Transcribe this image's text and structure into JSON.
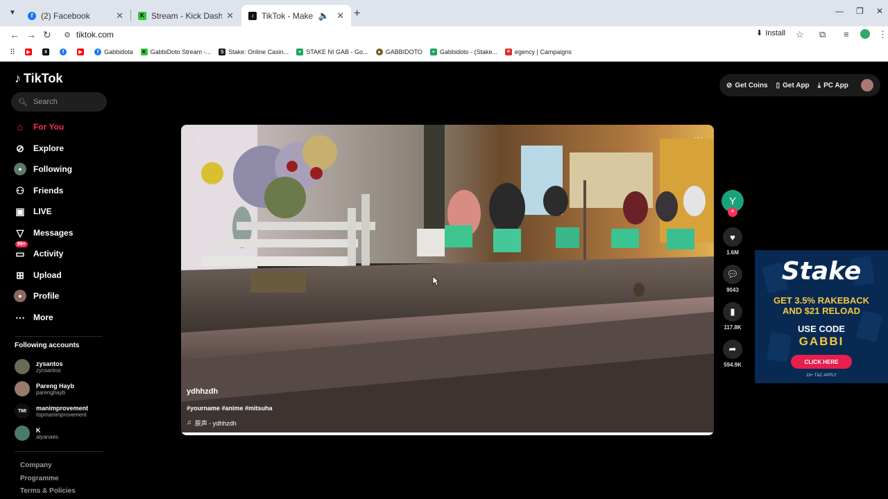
{
  "browser": {
    "tabs": [
      {
        "title": "(2) Facebook",
        "favicon": "f",
        "color": "#1877f2"
      },
      {
        "title": "Stream - Kick Dashboard",
        "favicon": "K",
        "color": "#3ac43a"
      },
      {
        "title": "TikTok - Make Your Day",
        "favicon": "♪",
        "color": "#111111"
      }
    ],
    "url": "tiktok.com",
    "install_label": "Install",
    "bookmarks": [
      {
        "label": "",
        "favicon": "▶",
        "color": "#ff0000"
      },
      {
        "label": "",
        "favicon": "X",
        "color": "#000000"
      },
      {
        "label": "",
        "favicon": "f",
        "color": "#1877f2"
      },
      {
        "label": "",
        "favicon": "▶",
        "color": "#ff0000"
      },
      {
        "label": "Gabbidota",
        "favicon": "f",
        "color": "#1877f2"
      },
      {
        "label": "GabbiDoto Stream -...",
        "favicon": "K",
        "color": "#3ac43a"
      },
      {
        "label": "Stake: Online Casin...",
        "favicon": "S",
        "color": "#1a1a1a"
      },
      {
        "label": "STAKE NI GAB - Go...",
        "favicon": "+",
        "color": "#21a366"
      },
      {
        "label": "GABBIDOTO",
        "favicon": "●",
        "color": "#7a5a20"
      },
      {
        "label": "Gabbidoto - (Stake...",
        "favicon": "+",
        "color": "#21a366"
      },
      {
        "label": "egency | Campaigns",
        "favicon": "⟡",
        "color": "#d93025"
      }
    ]
  },
  "tiktok": {
    "logo": "TikTok",
    "search_placeholder": "Search",
    "nav": [
      {
        "label": "For You",
        "icon": "home-icon"
      },
      {
        "label": "Explore",
        "icon": "compass-icon"
      },
      {
        "label": "Following",
        "icon": "following-avatar-icon"
      },
      {
        "label": "Friends",
        "icon": "friends-icon"
      },
      {
        "label": "LIVE",
        "icon": "live-icon"
      },
      {
        "label": "Messages",
        "icon": "messages-icon"
      },
      {
        "label": "Activity",
        "icon": "activity-icon",
        "badge": "99+"
      },
      {
        "label": "Upload",
        "icon": "upload-icon"
      },
      {
        "label": "Profile",
        "icon": "profile-avatar-icon"
      },
      {
        "label": "More",
        "icon": "more-icon"
      }
    ],
    "following_header": "Following accounts",
    "following_accounts": [
      {
        "name": "zysantos",
        "handle": "zycsantos"
      },
      {
        "name": "Pareng Hayb",
        "handle": "parenghayb"
      },
      {
        "name": "manimprovement",
        "handle": "topmanimprovement",
        "avatar_text": "TMI"
      },
      {
        "name": "K",
        "handle": "alyanaes"
      }
    ],
    "footer_links": [
      "Company",
      "Programme",
      "Terms & Policies"
    ],
    "top_actions": [
      "Get Coins",
      "Get App",
      "PC App"
    ],
    "video": {
      "author": "ydhhzdh",
      "tags": "#yourname #anime #mitsuha",
      "music": "原声 - ydhhzdh",
      "progress": 1.0
    },
    "creator_avatar_letter": "Y",
    "stats": {
      "likes": "1.6M",
      "comments": "9043",
      "saves": "117.8K",
      "shares": "594.9K"
    }
  },
  "ad": {
    "brand": "Stake",
    "offer_line1": "GET 3.5% RAKEBACK",
    "offer_line2": "AND $21 RELOAD",
    "use_code": "USE CODE",
    "code": "GABBI",
    "cta": "CLICK HERE",
    "terms": "18+ T&C APPLY"
  }
}
